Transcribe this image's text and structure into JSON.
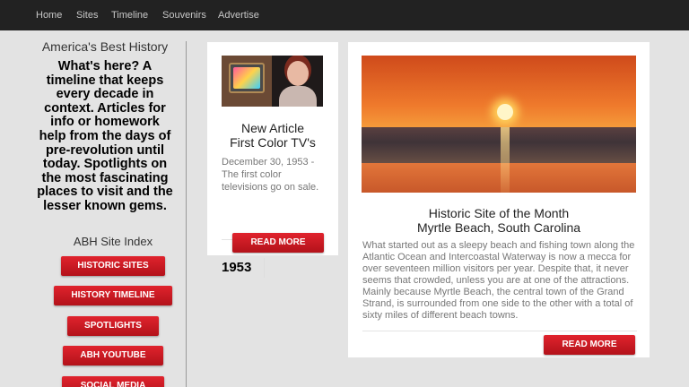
{
  "nav": {
    "items": [
      "Home",
      "Sites",
      "Timeline",
      "Souvenirs",
      "Advertise"
    ]
  },
  "sidebar": {
    "title": "America's Best History",
    "description": "What's here? A timeline that keeps every decade in context. Articles for info or homework help from the days of pre-revolution until today. Spotlights on the most fascinating places to visit and the lesser known gems.",
    "index_title": "ABH Site Index",
    "buttons": [
      "HISTORIC SITES",
      "HISTORY TIMELINE",
      "SPOTLIGHTS",
      "ABH YOUTUBE",
      "SOCIAL MEDIA"
    ]
  },
  "article_card": {
    "title_line1": "New Article",
    "title_line2": "First Color TV's",
    "text": "December 30, 1953 - The first color televisions go on sale.",
    "year": "1953",
    "button_label": "READ MORE"
  },
  "historic_site": {
    "title_line1": "Historic Site of the Month",
    "title_line2": "Myrtle Beach, South Carolina",
    "text": "What started out as a sleepy beach and fishing town along the Atlantic Ocean and Intercoastal Waterway is now a mecca for over seventeen million visitors per year. Despite that, it never seems that crowded, unless you are at one of the attractions. Mainly because Myrtle Beach, the central town of the Grand Strand, is surrounded from one side to the other with a total of sixty miles of different beach towns.",
    "button_label": "READ MORE"
  },
  "colors": {
    "nav_background": "#222222",
    "button_red": "#c8161f",
    "page_background": "#e3e3e3"
  }
}
